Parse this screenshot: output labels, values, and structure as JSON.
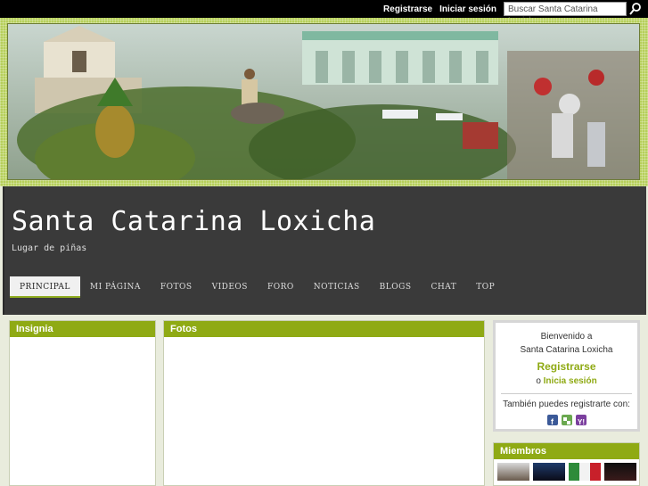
{
  "topbar": {
    "register": "Registrarse",
    "login": "Iniciar sesión",
    "search_placeholder": "Buscar Santa Catarina Loxicha"
  },
  "header": {
    "title": "Santa Catarina Loxicha",
    "subtitle": "Lugar de piñas"
  },
  "nav": {
    "items": [
      "PRINCIPAL",
      "MI PÁGINA",
      "FOTOS",
      "VIDEOS",
      "FORO",
      "NOTICIAS",
      "BLOGS",
      "CHAT",
      "TOP"
    ],
    "active": "PRINCIPAL"
  },
  "panels": {
    "badge": "Insignia",
    "photos": "Fotos",
    "members": "Miembros"
  },
  "signin": {
    "welcome": "Bienvenido a",
    "site": "Santa Catarina Loxicha",
    "register": "Registrarse",
    "or": "o",
    "login": "Inicia sesión",
    "also": "También puedes registrarte con:"
  },
  "colors": {
    "accent": "#8faa14",
    "header_bg": "#3a3a3a",
    "banner_frame": "#b6cf5a"
  }
}
